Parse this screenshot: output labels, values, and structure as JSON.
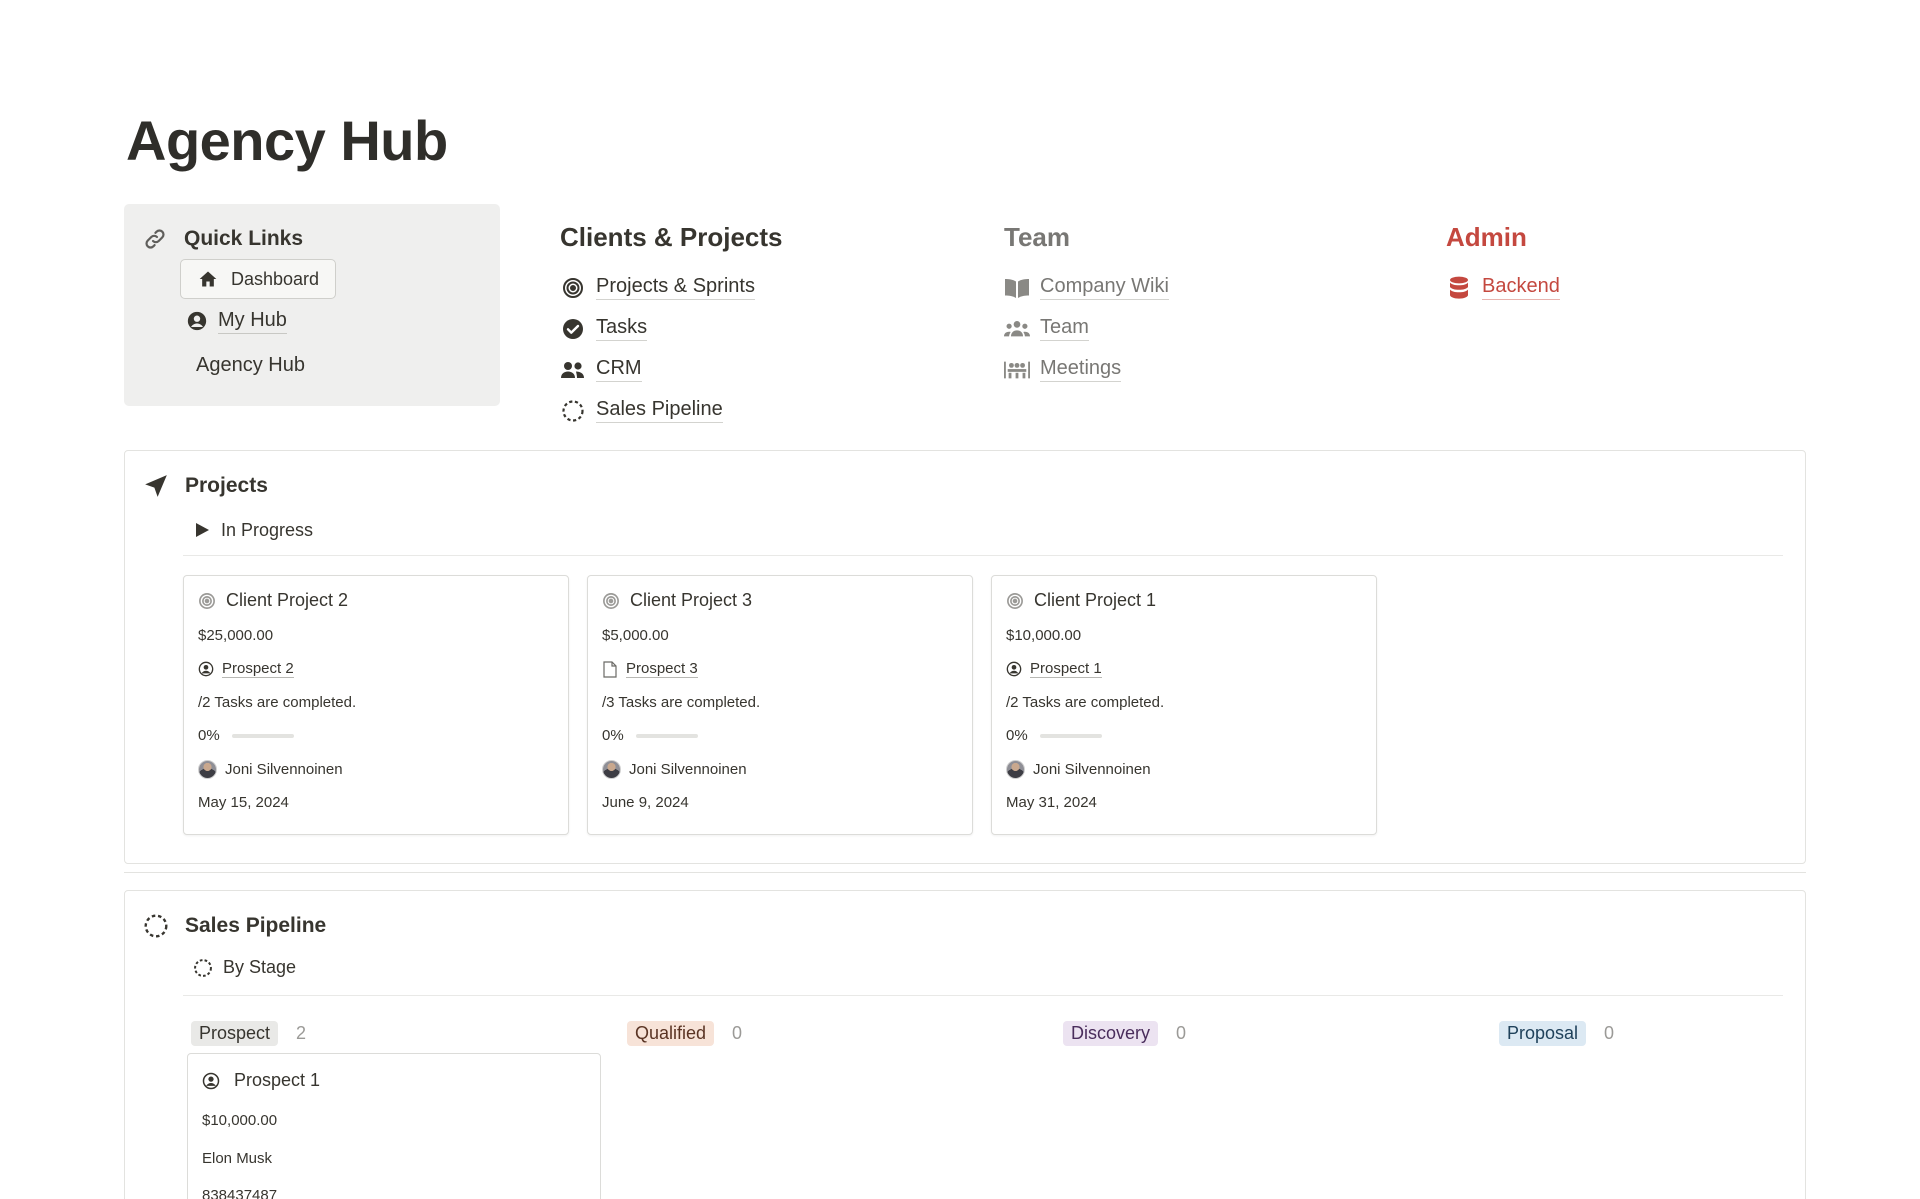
{
  "page": {
    "title": "Agency Hub"
  },
  "quick_links": {
    "heading": "Quick Links",
    "dashboard_label": "Dashboard",
    "my_hub_label": "My Hub",
    "agency_hub_label": "Agency Hub"
  },
  "nav": {
    "clients": {
      "heading": "Clients & Projects",
      "items": [
        "Projects & Sprints",
        "Tasks",
        "CRM",
        "Sales Pipeline"
      ]
    },
    "team": {
      "heading": "Team",
      "items": [
        "Company Wiki",
        "Team",
        "Meetings"
      ]
    },
    "admin": {
      "heading": "Admin",
      "items": [
        "Backend"
      ]
    }
  },
  "colors": {
    "admin": "#c4483f",
    "team_gray": "#787774",
    "text": "#37352f"
  },
  "projects": {
    "heading": "Projects",
    "view_label": "In Progress",
    "cards": [
      {
        "title": "Client Project 2",
        "budget": "$25,000.00",
        "client": "Prospect 2",
        "client_icon": "person-circle-icon",
        "tasks": "/2 Tasks are completed.",
        "progress": "0%",
        "owner": "Joni Silvennoinen",
        "date": "May 15, 2024"
      },
      {
        "title": "Client Project 3",
        "budget": "$5,000.00",
        "client": "Prospect 3",
        "client_icon": "page-icon",
        "tasks": "/3 Tasks are completed.",
        "progress": "0%",
        "owner": "Joni Silvennoinen",
        "date": "June 9, 2024"
      },
      {
        "title": "Client Project 1",
        "budget": "$10,000.00",
        "client": "Prospect 1",
        "client_icon": "person-circle-icon",
        "tasks": "/2 Tasks are completed.",
        "progress": "0%",
        "owner": "Joni Silvennoinen",
        "date": "May 31, 2024"
      }
    ]
  },
  "pipeline": {
    "heading": "Sales Pipeline",
    "view_label": "By Stage",
    "stages": [
      {
        "name": "Prospect",
        "count": "2",
        "color": "#e9e9e7"
      },
      {
        "name": "Qualified",
        "count": "0",
        "color": "#f7e3d8"
      },
      {
        "name": "Discovery",
        "count": "0",
        "color": "#ece3f1"
      },
      {
        "name": "Proposal",
        "count": "0",
        "color": "#dce9f3"
      }
    ],
    "card": {
      "title": "Prospect 1",
      "value": "$10,000.00",
      "contact": "Elon Musk",
      "phone": "838437487"
    }
  }
}
